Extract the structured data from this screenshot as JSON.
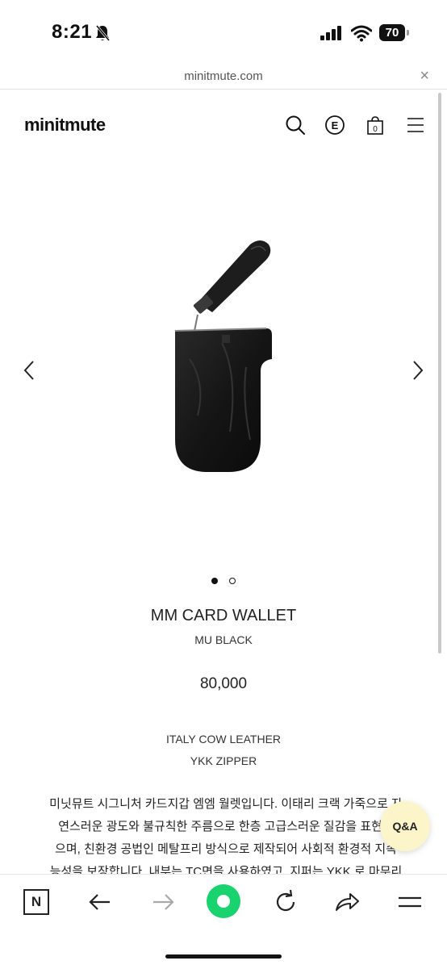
{
  "status_bar": {
    "time": "8:21",
    "battery": "70"
  },
  "url_bar": {
    "url": "minitmute.com",
    "close": "×"
  },
  "header": {
    "logo": "minitmute",
    "cart_count": "0",
    "e_badge": "E"
  },
  "product": {
    "name": "MM CARD WALLET",
    "color": "MU BLACK",
    "price": "80,000",
    "specs": [
      "ITALY COW LEATHER",
      "YKK ZIPPER"
    ],
    "image_index": 1,
    "image_count": 2,
    "description_lines": [
      "미닛뮤트 시그니처 카드지갑 엠엠 월렛입니다. 이태리 크랙 가죽으로 자",
      "연스러운 광도와 불규칙한 주름으로 한층 고급스러운 질감을 표현하",
      "으며, 친환경 공법인 메탈프리 방식으로 제작되어 사회적 환경적 지속",
      "능성을 보장합니다. 내부는 TC면을 사용하였고, 지퍼는 YKK 로 마무리"
    ]
  },
  "qa_button": "Q&A",
  "toolbar": {
    "n_label": "N"
  },
  "colors": {
    "accent_green": "#19d46e",
    "qa_bg": "#fbf5c9"
  }
}
